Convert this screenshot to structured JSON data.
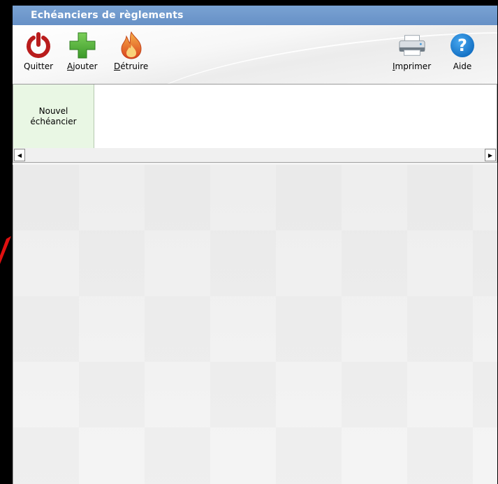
{
  "window": {
    "title": "Echéanciers de règlements"
  },
  "toolbar": {
    "quit": {
      "label_underlined": "",
      "label_rest": "Quitter",
      "icon": "power-icon",
      "color": "#b91c1c"
    },
    "add": {
      "label_underlined": "A",
      "label_rest": "jouter",
      "icon": "plus-icon",
      "color": "#4cae3a"
    },
    "destroy": {
      "label_underlined": "D",
      "label_rest": "étruire",
      "icon": "flame-icon",
      "color": "#e8622a"
    },
    "print": {
      "label_underlined": "I",
      "label_rest": "mprimer",
      "icon": "printer-icon"
    },
    "help": {
      "label_underlined": "",
      "label_rest": "Aide",
      "icon": "help-icon",
      "color": "#1a7fd4"
    }
  },
  "tabs": {
    "new_line1": "Nouvel",
    "new_line2": "échéancier"
  },
  "scrollbar": {
    "left_arrow": "◀",
    "right_arrow": "▶"
  },
  "colors": {
    "titlebar": "#6f98cc",
    "tab_background": "#e9f7e4",
    "annotation_arrow": "#e01010"
  }
}
